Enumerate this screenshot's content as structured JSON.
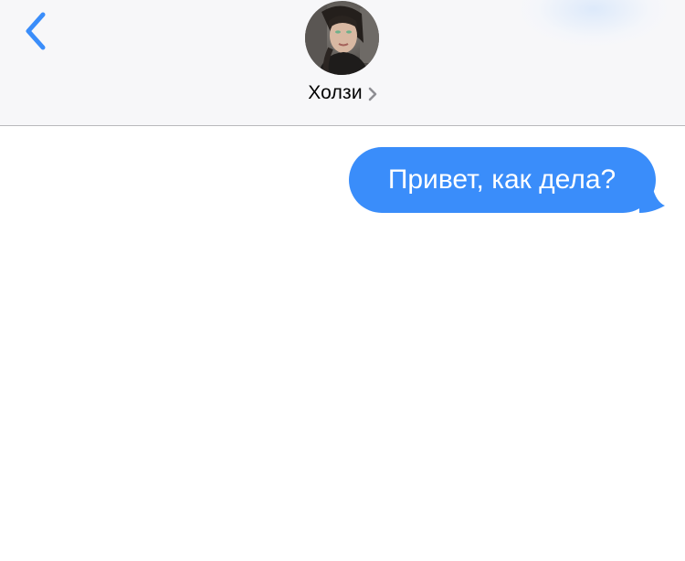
{
  "colors": {
    "accent": "#3a8dfa",
    "header_background": "#f7f7f9",
    "bubble_text": "#ffffff"
  },
  "header": {
    "back_icon": "chevron-left-icon",
    "contact_name": "Холзи",
    "contact_chevron_icon": "chevron-right-icon",
    "avatar_icon": "contact-avatar"
  },
  "messages": [
    {
      "direction": "outgoing",
      "text": "Привет, как дела?"
    }
  ]
}
